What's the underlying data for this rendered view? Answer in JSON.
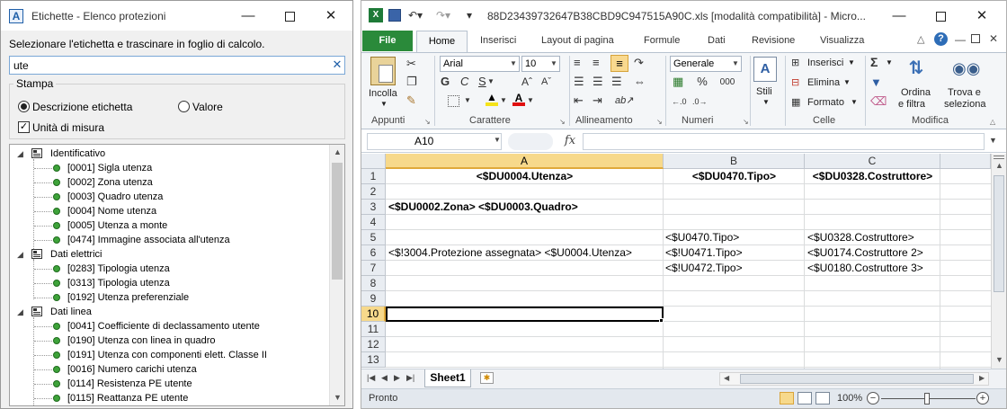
{
  "left_window": {
    "title": "Etichette - Elenco protezioni",
    "app_icon_letter": "A",
    "instruction": "Selezionare l'etichetta e trascinare in foglio di calcolo.",
    "search": {
      "value": "ute"
    },
    "stampa": {
      "legend": "Stampa",
      "option_descrizione": "Descrizione etichetta",
      "option_valore": "Valore",
      "selected": "Descrizione etichetta",
      "checkbox_label": "Unità di misura",
      "checkbox_checked": true
    },
    "tree": {
      "groups": [
        {
          "label": "Identificativo",
          "items": [
            "[0001] Sigla utenza",
            "[0002] Zona utenza",
            "[0003] Quadro utenza",
            "[0004] Nome utenza",
            "[0005] Utenza a monte",
            "[0474] Immagine associata all'utenza"
          ]
        },
        {
          "label": "Dati elettrici",
          "items": [
            "[0283] Tipologia utenza",
            "[0313] Tipologia utenza",
            "[0192] Utenza preferenziale"
          ]
        },
        {
          "label": "Dati linea",
          "items": [
            "[0041] Coefficiente di declassamento utente",
            "[0190] Utenza con linea in quadro",
            "[0191] Utenza con componenti elett. Classe II",
            "[0016] Numero carichi utenza",
            "[0114] Resistenza PE utente",
            "[0115] Reattanza PE utente"
          ]
        }
      ]
    }
  },
  "excel": {
    "title": "88D23439732647B38CBD9C947515A90C.xls  [modalità compatibilità]  -  Micro...",
    "tabs": [
      "File",
      "Home",
      "Inserisci",
      "Layout di pagina",
      "Formule",
      "Dati",
      "Revisione",
      "Visualizza"
    ],
    "active_tab": "Home",
    "ribbon": {
      "incolla": "Incolla",
      "appunti": "Appunti",
      "font_name": "Arial",
      "font_size": "10",
      "bold": "G",
      "italic": "C",
      "underline": "S",
      "carattere": "Carattere",
      "allineamento": "Allineamento",
      "number_format": "Generale",
      "percent": "%",
      "thousands": "000",
      "numeri": "Numeri",
      "stili": "Stili",
      "inserisci": "Inserisci",
      "elimina": "Elimina",
      "formato": "Formato",
      "celle": "Celle",
      "sigma": "Σ",
      "ordina_line1": "Ordina",
      "ordina_line2": "e filtra",
      "trova_line1": "Trova e",
      "trova_line2": "seleziona",
      "modifica": "Modifica"
    },
    "namebox": "A10",
    "fx": "fx",
    "columns": [
      "A",
      "B",
      "C"
    ],
    "selected_column": "A",
    "rows": [
      "1",
      "2",
      "3",
      "4",
      "5",
      "6",
      "7",
      "8",
      "9",
      "10",
      "11",
      "12",
      "13"
    ],
    "selected_row": "10",
    "cells": {
      "A1": "<$DU0004.Utenza>",
      "B1": "<$DU0470.Tipo>",
      "C1": "<$DU0328.Costruttore>",
      "A3": "<$DU0002.Zona> <$DU0003.Quadro>",
      "B5": "<$U0470.Tipo>",
      "C5": "<$U0328.Costruttore>",
      "A6": "<$!3004.Protezione assegnata> <$U0004.Utenza>",
      "B6": "<$!U0471.Tipo>",
      "C6": "<$U0174.Costruttore 2>",
      "B7": "<$!U0472.Tipo>",
      "C7": "<$U0180.Costruttore 3>"
    },
    "sheet_tab": "Sheet1",
    "status": "Pronto",
    "zoom": "100%",
    "zoom_level_percent": 100
  },
  "colors": {
    "accent_file_tab": "#2a8a3a",
    "selection_header": "#f7d98b",
    "tree_dot": "#3ea33a"
  }
}
